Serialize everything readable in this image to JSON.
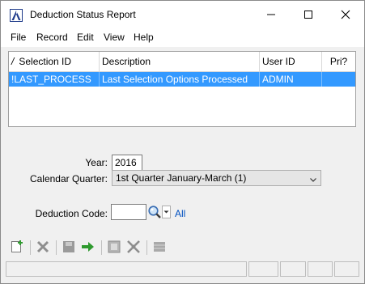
{
  "window": {
    "title": "Deduction Status Report",
    "icon": "A"
  },
  "menu": [
    "File",
    "Record",
    "Edit",
    "View",
    "Help"
  ],
  "grid": {
    "columns": [
      "Selection ID",
      "Description",
      "User ID",
      "Pri?"
    ],
    "rows": [
      {
        "selection_id": "!LAST_PROCESS",
        "description": "Last Selection Options Processed",
        "user_id": "ADMIN",
        "pri": ""
      }
    ],
    "selected_color": "#3399ff"
  },
  "form": {
    "year_label": "Year:",
    "year_value": "2016",
    "quarter_label": "Calendar Quarter:",
    "quarter_value": "1st Quarter January-March (1)",
    "deduction_label": "Deduction Code:",
    "deduction_value": "",
    "all_link": "All"
  },
  "toolbar": {
    "buttons": [
      "new-record-icon",
      "delete-icon",
      "save-icon",
      "process-arrow-icon",
      "import-icon",
      "export-icon",
      "list-icon"
    ]
  }
}
